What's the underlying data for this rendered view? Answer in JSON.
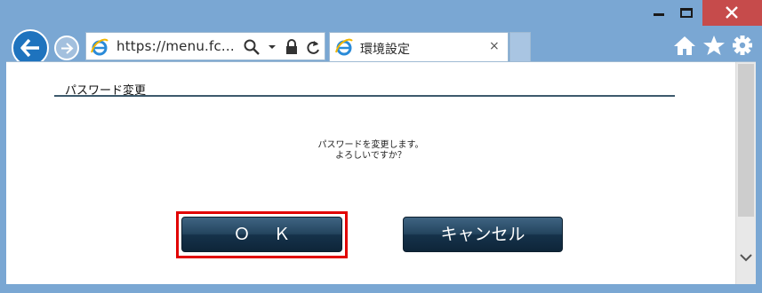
{
  "window": {
    "minimize_icon": "minimize-icon",
    "maximize_icon": "maximize-icon",
    "close_icon": "close-icon"
  },
  "toolbar": {
    "back_icon": "back-arrow-icon",
    "forward_icon": "forward-arrow-icon",
    "address": "https://menu.fc...",
    "tab_title": "環境設定",
    "tab_close": "×",
    "home_icon": "home-icon",
    "favorites_icon": "star-icon",
    "tools_icon": "gear-icon"
  },
  "page": {
    "section_title": "パスワード変更",
    "message_line1": "パスワードを変更します。",
    "message_line2": "よろしいですか？",
    "ok_label": "ＯＫ",
    "cancel_label": "キャンセル"
  },
  "colors": {
    "window_frame": "#7aa7d3",
    "close_button": "#c64b4b",
    "button_navy": "#1c3a52",
    "highlight_red": "#e10000",
    "rule": "#3d5a6c"
  }
}
